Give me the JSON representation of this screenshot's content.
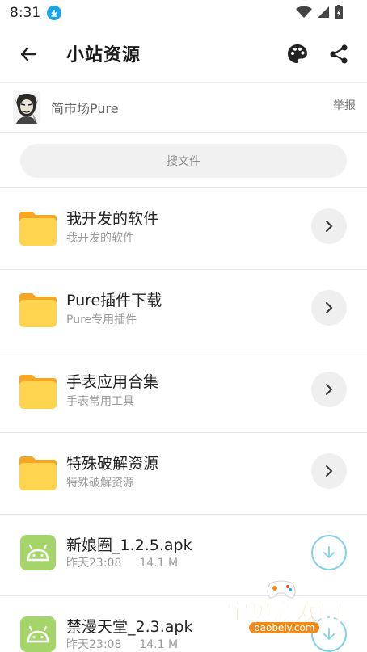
{
  "status": {
    "time": "8:31"
  },
  "appbar": {
    "title": "小站资源"
  },
  "owner": {
    "name": "简市场Pure",
    "report_label": "举报"
  },
  "search": {
    "placeholder": "搜文件"
  },
  "folders": [
    {
      "title": "我开发的软件",
      "subtitle": "我开发的软件"
    },
    {
      "title": "Pure插件下载",
      "subtitle": "Pure专用插件"
    },
    {
      "title": "手表应用合集",
      "subtitle": "手表常用工具"
    },
    {
      "title": "特殊破解资源",
      "subtitle": "特殊破解资源"
    }
  ],
  "files": [
    {
      "name": "新娘圈_1.2.5.apk",
      "date": "昨天23:08",
      "size": "14.1 M"
    },
    {
      "name": "禁漫天堂_2.3.apk",
      "date": "昨天23:08",
      "size": "14.1 M"
    }
  ],
  "watermark": {
    "text": "宝贝游戏网",
    "url": "baobeiy.com"
  },
  "colors": {
    "accent": "#1aa3e8",
    "folder": "#ffd54f",
    "apk": "#a5d56a",
    "download_ring": "#7fd1ea"
  }
}
